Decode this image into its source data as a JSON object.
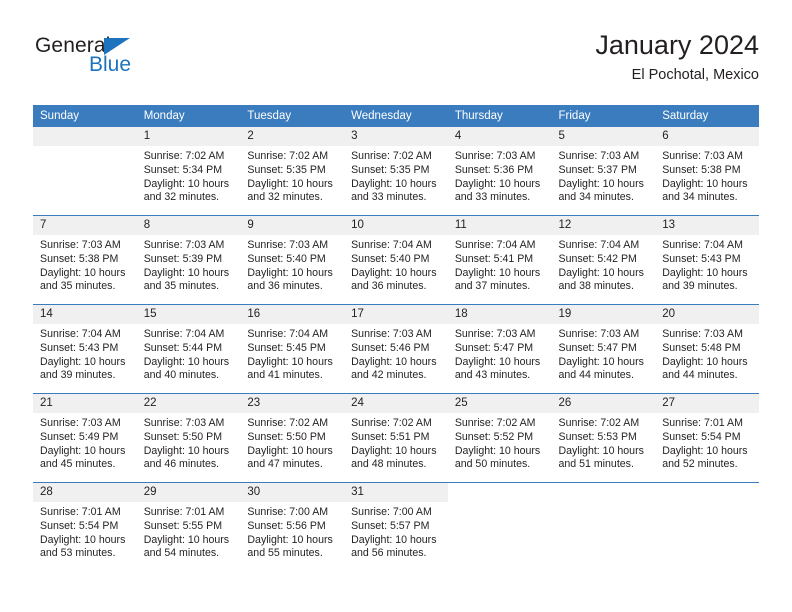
{
  "brand": {
    "name_part1": "General",
    "name_part2": "Blue",
    "triangle_color": "#1e73be",
    "text_color": "#231f20"
  },
  "header": {
    "title": "January 2024",
    "subtitle": "El Pochotal, Mexico"
  },
  "theme": {
    "header_bar_color": "#3a7cbe",
    "daynum_strip_color": "#f0f0f0",
    "grid_line_color": "#3a7cbe",
    "text_color": "#231f20"
  },
  "weekday_headers": [
    "Sunday",
    "Monday",
    "Tuesday",
    "Wednesday",
    "Thursday",
    "Friday",
    "Saturday"
  ],
  "weeks": [
    [
      {
        "day": "",
        "sunrise": "",
        "sunset": "",
        "daylight1": "",
        "daylight2": "",
        "empty": true
      },
      {
        "day": "1",
        "sunrise": "Sunrise: 7:02 AM",
        "sunset": "Sunset: 5:34 PM",
        "daylight1": "Daylight: 10 hours",
        "daylight2": "and 32 minutes."
      },
      {
        "day": "2",
        "sunrise": "Sunrise: 7:02 AM",
        "sunset": "Sunset: 5:35 PM",
        "daylight1": "Daylight: 10 hours",
        "daylight2": "and 32 minutes."
      },
      {
        "day": "3",
        "sunrise": "Sunrise: 7:02 AM",
        "sunset": "Sunset: 5:35 PM",
        "daylight1": "Daylight: 10 hours",
        "daylight2": "and 33 minutes."
      },
      {
        "day": "4",
        "sunrise": "Sunrise: 7:03 AM",
        "sunset": "Sunset: 5:36 PM",
        "daylight1": "Daylight: 10 hours",
        "daylight2": "and 33 minutes."
      },
      {
        "day": "5",
        "sunrise": "Sunrise: 7:03 AM",
        "sunset": "Sunset: 5:37 PM",
        "daylight1": "Daylight: 10 hours",
        "daylight2": "and 34 minutes."
      },
      {
        "day": "6",
        "sunrise": "Sunrise: 7:03 AM",
        "sunset": "Sunset: 5:38 PM",
        "daylight1": "Daylight: 10 hours",
        "daylight2": "and 34 minutes."
      }
    ],
    [
      {
        "day": "7",
        "sunrise": "Sunrise: 7:03 AM",
        "sunset": "Sunset: 5:38 PM",
        "daylight1": "Daylight: 10 hours",
        "daylight2": "and 35 minutes."
      },
      {
        "day": "8",
        "sunrise": "Sunrise: 7:03 AM",
        "sunset": "Sunset: 5:39 PM",
        "daylight1": "Daylight: 10 hours",
        "daylight2": "and 35 minutes."
      },
      {
        "day": "9",
        "sunrise": "Sunrise: 7:03 AM",
        "sunset": "Sunset: 5:40 PM",
        "daylight1": "Daylight: 10 hours",
        "daylight2": "and 36 minutes."
      },
      {
        "day": "10",
        "sunrise": "Sunrise: 7:04 AM",
        "sunset": "Sunset: 5:40 PM",
        "daylight1": "Daylight: 10 hours",
        "daylight2": "and 36 minutes."
      },
      {
        "day": "11",
        "sunrise": "Sunrise: 7:04 AM",
        "sunset": "Sunset: 5:41 PM",
        "daylight1": "Daylight: 10 hours",
        "daylight2": "and 37 minutes."
      },
      {
        "day": "12",
        "sunrise": "Sunrise: 7:04 AM",
        "sunset": "Sunset: 5:42 PM",
        "daylight1": "Daylight: 10 hours",
        "daylight2": "and 38 minutes."
      },
      {
        "day": "13",
        "sunrise": "Sunrise: 7:04 AM",
        "sunset": "Sunset: 5:43 PM",
        "daylight1": "Daylight: 10 hours",
        "daylight2": "and 39 minutes."
      }
    ],
    [
      {
        "day": "14",
        "sunrise": "Sunrise: 7:04 AM",
        "sunset": "Sunset: 5:43 PM",
        "daylight1": "Daylight: 10 hours",
        "daylight2": "and 39 minutes."
      },
      {
        "day": "15",
        "sunrise": "Sunrise: 7:04 AM",
        "sunset": "Sunset: 5:44 PM",
        "daylight1": "Daylight: 10 hours",
        "daylight2": "and 40 minutes."
      },
      {
        "day": "16",
        "sunrise": "Sunrise: 7:04 AM",
        "sunset": "Sunset: 5:45 PM",
        "daylight1": "Daylight: 10 hours",
        "daylight2": "and 41 minutes."
      },
      {
        "day": "17",
        "sunrise": "Sunrise: 7:03 AM",
        "sunset": "Sunset: 5:46 PM",
        "daylight1": "Daylight: 10 hours",
        "daylight2": "and 42 minutes."
      },
      {
        "day": "18",
        "sunrise": "Sunrise: 7:03 AM",
        "sunset": "Sunset: 5:47 PM",
        "daylight1": "Daylight: 10 hours",
        "daylight2": "and 43 minutes."
      },
      {
        "day": "19",
        "sunrise": "Sunrise: 7:03 AM",
        "sunset": "Sunset: 5:47 PM",
        "daylight1": "Daylight: 10 hours",
        "daylight2": "and 44 minutes."
      },
      {
        "day": "20",
        "sunrise": "Sunrise: 7:03 AM",
        "sunset": "Sunset: 5:48 PM",
        "daylight1": "Daylight: 10 hours",
        "daylight2": "and 44 minutes."
      }
    ],
    [
      {
        "day": "21",
        "sunrise": "Sunrise: 7:03 AM",
        "sunset": "Sunset: 5:49 PM",
        "daylight1": "Daylight: 10 hours",
        "daylight2": "and 45 minutes."
      },
      {
        "day": "22",
        "sunrise": "Sunrise: 7:03 AM",
        "sunset": "Sunset: 5:50 PM",
        "daylight1": "Daylight: 10 hours",
        "daylight2": "and 46 minutes."
      },
      {
        "day": "23",
        "sunrise": "Sunrise: 7:02 AM",
        "sunset": "Sunset: 5:50 PM",
        "daylight1": "Daylight: 10 hours",
        "daylight2": "and 47 minutes."
      },
      {
        "day": "24",
        "sunrise": "Sunrise: 7:02 AM",
        "sunset": "Sunset: 5:51 PM",
        "daylight1": "Daylight: 10 hours",
        "daylight2": "and 48 minutes."
      },
      {
        "day": "25",
        "sunrise": "Sunrise: 7:02 AM",
        "sunset": "Sunset: 5:52 PM",
        "daylight1": "Daylight: 10 hours",
        "daylight2": "and 50 minutes."
      },
      {
        "day": "26",
        "sunrise": "Sunrise: 7:02 AM",
        "sunset": "Sunset: 5:53 PM",
        "daylight1": "Daylight: 10 hours",
        "daylight2": "and 51 minutes."
      },
      {
        "day": "27",
        "sunrise": "Sunrise: 7:01 AM",
        "sunset": "Sunset: 5:54 PM",
        "daylight1": "Daylight: 10 hours",
        "daylight2": "and 52 minutes."
      }
    ],
    [
      {
        "day": "28",
        "sunrise": "Sunrise: 7:01 AM",
        "sunset": "Sunset: 5:54 PM",
        "daylight1": "Daylight: 10 hours",
        "daylight2": "and 53 minutes."
      },
      {
        "day": "29",
        "sunrise": "Sunrise: 7:01 AM",
        "sunset": "Sunset: 5:55 PM",
        "daylight1": "Daylight: 10 hours",
        "daylight2": "and 54 minutes."
      },
      {
        "day": "30",
        "sunrise": "Sunrise: 7:00 AM",
        "sunset": "Sunset: 5:56 PM",
        "daylight1": "Daylight: 10 hours",
        "daylight2": "and 55 minutes."
      },
      {
        "day": "31",
        "sunrise": "Sunrise: 7:00 AM",
        "sunset": "Sunset: 5:57 PM",
        "daylight1": "Daylight: 10 hours",
        "daylight2": "and 56 minutes."
      },
      {
        "day": "",
        "sunrise": "",
        "sunset": "",
        "daylight1": "",
        "daylight2": "",
        "blank": true
      },
      {
        "day": "",
        "sunrise": "",
        "sunset": "",
        "daylight1": "",
        "daylight2": "",
        "blank": true
      },
      {
        "day": "",
        "sunrise": "",
        "sunset": "",
        "daylight1": "",
        "daylight2": "",
        "blank": true
      }
    ]
  ]
}
